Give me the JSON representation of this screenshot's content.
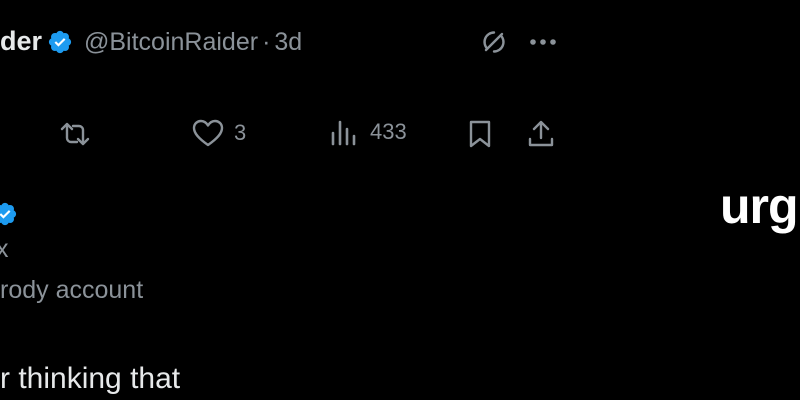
{
  "post": {
    "author_name_fragment": "der",
    "handle": "@BitcoinRaider",
    "separator": "·",
    "time_ago": "3d",
    "stats": {
      "likes": "3",
      "views": "433"
    }
  },
  "second_post": {
    "name_line_fragment": "x",
    "parody_label_fragment": "rody account",
    "text_fragment": "r thinking that"
  },
  "overlay": {
    "caption_fragment": "urg"
  },
  "colors": {
    "background": "#000000",
    "text_primary": "#e7e9ea",
    "text_secondary": "#8b9299",
    "verified_blue": "#1d9bf0"
  },
  "icons": {
    "verified": "verified-badge-icon",
    "grok": "grok-icon",
    "more": "more-icon",
    "repost": "repost-icon",
    "like": "heart-icon",
    "views": "views-icon",
    "bookmark": "bookmark-icon",
    "share": "share-icon"
  }
}
